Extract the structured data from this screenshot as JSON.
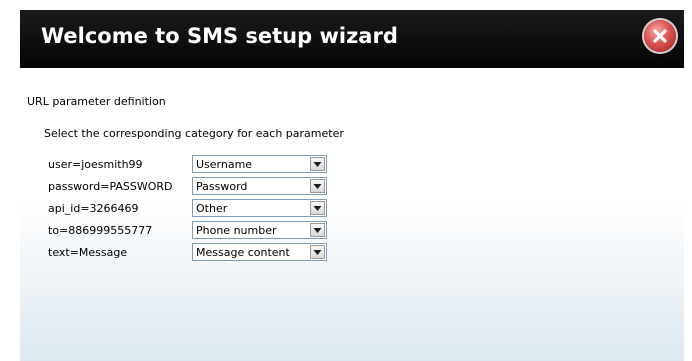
{
  "dialog": {
    "title": "Welcome to SMS setup wizard",
    "section_title": "URL parameter definition",
    "instruction": "Select the corresponding category for each parameter",
    "close_icon": "close-icon",
    "params": [
      {
        "label": "user=joesmith99",
        "selected": "Username"
      },
      {
        "label": "password=PASSWORD",
        "selected": "Password"
      },
      {
        "label": "api_id=3266469",
        "selected": "Other"
      },
      {
        "label": "to=886999555777",
        "selected": "Phone number"
      },
      {
        "label": "text=Message",
        "selected": "Message content"
      }
    ]
  },
  "colors": {
    "title_bar": "#0a0a0a",
    "close_button": "#d9544f",
    "select_border": "#7f9db9"
  }
}
